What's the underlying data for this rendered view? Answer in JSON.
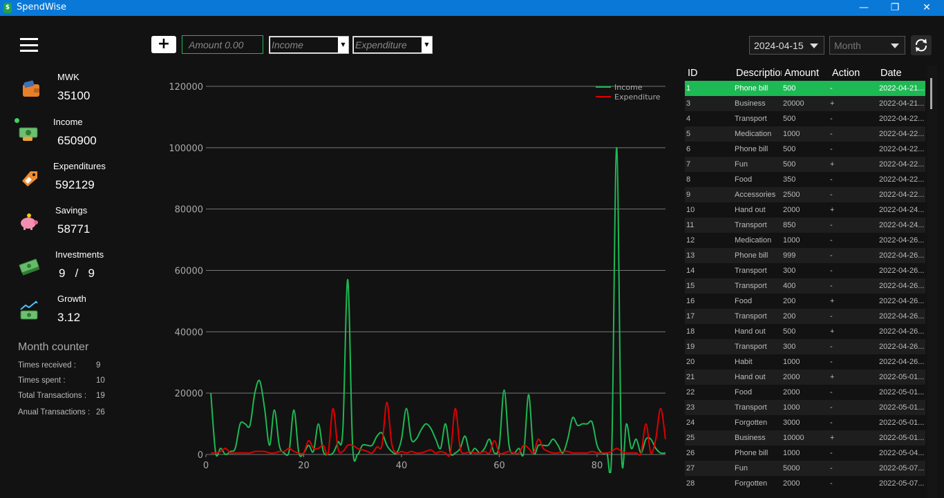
{
  "window": {
    "title": "SpendWise",
    "minimize": "—",
    "restore": "❐",
    "close": "✕"
  },
  "sidebar": {
    "stats": [
      {
        "label": "MWK",
        "value": "35100",
        "icon": "wallet-icon"
      },
      {
        "label": "Income",
        "value": "650900",
        "icon": "cash-icon"
      },
      {
        "label": "Expenditures",
        "value": "592129",
        "icon": "price-tag-icon"
      },
      {
        "label": "Savings",
        "value": "58771",
        "icon": "piggy-bank-icon"
      },
      {
        "label": "Investments",
        "value": "9   /   9",
        "icon": "money-stack-icon"
      },
      {
        "label": "Growth",
        "value": "3.12",
        "icon": "growth-chart-icon"
      }
    ],
    "month_counter": {
      "title": "Month counter",
      "rows": [
        {
          "label": "Times received :",
          "value": "9"
        },
        {
          "label": "Times spent :",
          "value": "10"
        },
        {
          "label": "Total Transactions :",
          "value": "19"
        },
        {
          "label": "Anual Transactions :",
          "value": "26"
        }
      ]
    }
  },
  "toolbar": {
    "add_label": "+",
    "amount_placeholder": "Amount 0.00",
    "income_placeholder": "Income",
    "expenditure_placeholder": "Expenditure",
    "date_value": "2024-04-15",
    "month_placeholder": "Month"
  },
  "chart_data": {
    "type": "line",
    "x": [
      1,
      2,
      3,
      4,
      5,
      6,
      7,
      8,
      9,
      10,
      11,
      12,
      13,
      14,
      15,
      16,
      17,
      18,
      19,
      20,
      21,
      22,
      23,
      24,
      25,
      26,
      27,
      28,
      29,
      30,
      31,
      32,
      33,
      34,
      35,
      36,
      37,
      38,
      39,
      40,
      41,
      42,
      43,
      44,
      45,
      46,
      47,
      48,
      49,
      50,
      51,
      52,
      53,
      54,
      55,
      56,
      57,
      58,
      59,
      60,
      61,
      62,
      63,
      64,
      65,
      66,
      67,
      68,
      69,
      70,
      71,
      72,
      73,
      74,
      75,
      76,
      77,
      78,
      79,
      80,
      81,
      82,
      83,
      84,
      85,
      86,
      87,
      88,
      89,
      90,
      91,
      92,
      93,
      94
    ],
    "series": [
      {
        "name": "Income",
        "color": "#1db954",
        "values": [
          20000,
          500,
          2000,
          0,
          1000,
          2000,
          10000,
          10000,
          9500,
          20000,
          24000,
          15000,
          3000,
          14500,
          3000,
          500,
          1000,
          14500,
          500,
          500,
          3000,
          1000,
          10000,
          1000,
          0,
          500,
          4000,
          8000,
          57000,
          3000,
          0,
          3000,
          3000,
          3000,
          6000,
          7000,
          3000,
          1000,
          500,
          5000,
          15000,
          5000,
          5000,
          8000,
          10000,
          8500,
          5000,
          2000,
          10000,
          500,
          500,
          2000,
          6000,
          500,
          2000,
          500,
          2000,
          5000,
          500,
          3000,
          21000,
          3000,
          500,
          2000,
          500,
          19500,
          1000,
          3000,
          3000,
          3000,
          5000,
          3000,
          500,
          5000,
          12000,
          9500,
          10000,
          10000,
          10500,
          3000,
          500,
          500,
          1000,
          100000,
          500,
          10000,
          2000,
          5000,
          500,
          5000,
          5000,
          2000,
          500,
          500
        ]
      },
      {
        "name": "Expenditure",
        "color": "#e00000",
        "values": [
          500,
          500,
          1000,
          2000,
          500,
          500,
          500,
          500,
          500,
          1000,
          1000,
          1000,
          500,
          500,
          1000,
          1000,
          2000,
          1000,
          500,
          500,
          4500,
          2000,
          2000,
          3000,
          500,
          15000,
          2000,
          1000,
          3000,
          3000,
          2000,
          1500,
          1000,
          500,
          2500,
          3000,
          17000,
          3500,
          500,
          1000,
          500,
          1000,
          500,
          500,
          1000,
          1500,
          500,
          1000,
          500,
          500,
          15000,
          2000,
          500,
          1000,
          500,
          500,
          1000,
          500,
          4500,
          500,
          500,
          1000,
          500,
          500,
          3000,
          2000,
          500,
          5000,
          2000,
          1000,
          500,
          500,
          1000,
          1000,
          500,
          500,
          500,
          500,
          1000,
          500,
          500,
          500,
          1000,
          2000,
          1000,
          500,
          500,
          500,
          500,
          10000,
          500,
          5000,
          15000,
          5000
        ]
      }
    ],
    "ylim": [
      0,
      120000
    ],
    "yticks": [
      "0",
      "20000",
      "40000",
      "60000",
      "80000",
      "100000",
      "120000"
    ],
    "xticks": [
      "0",
      "20",
      "40",
      "60",
      "80"
    ],
    "xlim": [
      0,
      94
    ],
    "grid": true,
    "legend": "top-right"
  },
  "table": {
    "headers": [
      "ID",
      "Description",
      "Amount",
      "Action",
      "Date"
    ],
    "rows": [
      [
        "1",
        "Phone bill",
        "500",
        "-",
        "2022-04-21..."
      ],
      [
        "3",
        "Business",
        "20000",
        "+",
        "2022-04-21..."
      ],
      [
        "4",
        "Transport",
        "500",
        "-",
        "2022-04-22..."
      ],
      [
        "5",
        "Medication",
        "1000",
        "-",
        "2022-04-22..."
      ],
      [
        "6",
        "Phone bill",
        "500",
        "-",
        "2022-04-22..."
      ],
      [
        "7",
        "Fun",
        "500",
        "+",
        "2022-04-22..."
      ],
      [
        "8",
        "Food",
        "350",
        "-",
        "2022-04-22..."
      ],
      [
        "9",
        "Accessories",
        "2500",
        "-",
        "2022-04-22..."
      ],
      [
        "10",
        "Hand out",
        "2000",
        "+",
        "2022-04-24..."
      ],
      [
        "11",
        "Transport",
        "850",
        "-",
        "2022-04-24..."
      ],
      [
        "12",
        "Medication",
        "1000",
        "-",
        "2022-04-26..."
      ],
      [
        "13",
        "Phone bill",
        "999",
        "-",
        "2022-04-26..."
      ],
      [
        "14",
        "Transport",
        "300",
        "-",
        "2022-04-26..."
      ],
      [
        "15",
        "Transport",
        "400",
        "-",
        "2022-04-26..."
      ],
      [
        "16",
        "Food",
        "200",
        "+",
        "2022-04-26..."
      ],
      [
        "17",
        "Transport",
        "200",
        "-",
        "2022-04-26..."
      ],
      [
        "18",
        "Hand out",
        "500",
        "+",
        "2022-04-26..."
      ],
      [
        "19",
        "Transport",
        "300",
        "-",
        "2022-04-26..."
      ],
      [
        "20",
        "Habit",
        "1000",
        "-",
        "2022-04-26..."
      ],
      [
        "21",
        "Hand out",
        "2000",
        "+",
        "2022-05-01..."
      ],
      [
        "22",
        "Food",
        "2000",
        "-",
        "2022-05-01..."
      ],
      [
        "23",
        "Transport",
        "1000",
        "-",
        "2022-05-01..."
      ],
      [
        "24",
        "Forgotten",
        "3000",
        "-",
        "2022-05-01..."
      ],
      [
        "25",
        "Business",
        "10000",
        "+",
        "2022-05-01..."
      ],
      [
        "26",
        "Phone bill",
        "1000",
        "-",
        "2022-05-04..."
      ],
      [
        "27",
        "Fun",
        "5000",
        "-",
        "2022-05-07..."
      ],
      [
        "28",
        "Forgotten",
        "2000",
        "-",
        "2022-05-07..."
      ]
    ]
  }
}
